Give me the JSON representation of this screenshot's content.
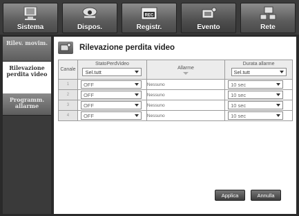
{
  "tabs": [
    {
      "label": "Sistema",
      "icon": "system-icon"
    },
    {
      "label": "Dispos.",
      "icon": "camera-icon"
    },
    {
      "label": "Registr.",
      "icon": "rec-icon",
      "icon_text": "REC"
    },
    {
      "label": "Evento",
      "icon": "event-icon"
    },
    {
      "label": "Rete",
      "icon": "network-icon"
    }
  ],
  "sidebar": {
    "items": [
      {
        "label": "Rilev. movim."
      },
      {
        "label": "Rilevazione perdita video"
      },
      {
        "label": "Programm. allarme"
      }
    ]
  },
  "panel": {
    "title": "Rilevazione perdita video"
  },
  "table": {
    "headers": {
      "channel": "Canale",
      "status": "StatoPerdVideo",
      "status_select": "Sel.tutt",
      "alarm": "Allarme",
      "duration": "Durata allarme",
      "duration_select": "Sel.tutt"
    },
    "rows": [
      {
        "ch": "1",
        "status": "OFF",
        "alarm": "Nessuno",
        "duration": "10 sec"
      },
      {
        "ch": "2",
        "status": "OFF",
        "alarm": "Nessuno",
        "duration": "10 sec"
      },
      {
        "ch": "3",
        "status": "OFF",
        "alarm": "Nessuno",
        "duration": "10 sec"
      },
      {
        "ch": "4",
        "status": "OFF",
        "alarm": "Nessuno",
        "duration": "10 sec"
      }
    ]
  },
  "buttons": {
    "apply": "Applica",
    "cancel": "Annulla"
  },
  "colors": {
    "active_bg": "#ffffff",
    "chrome": "#3a3a3a"
  }
}
